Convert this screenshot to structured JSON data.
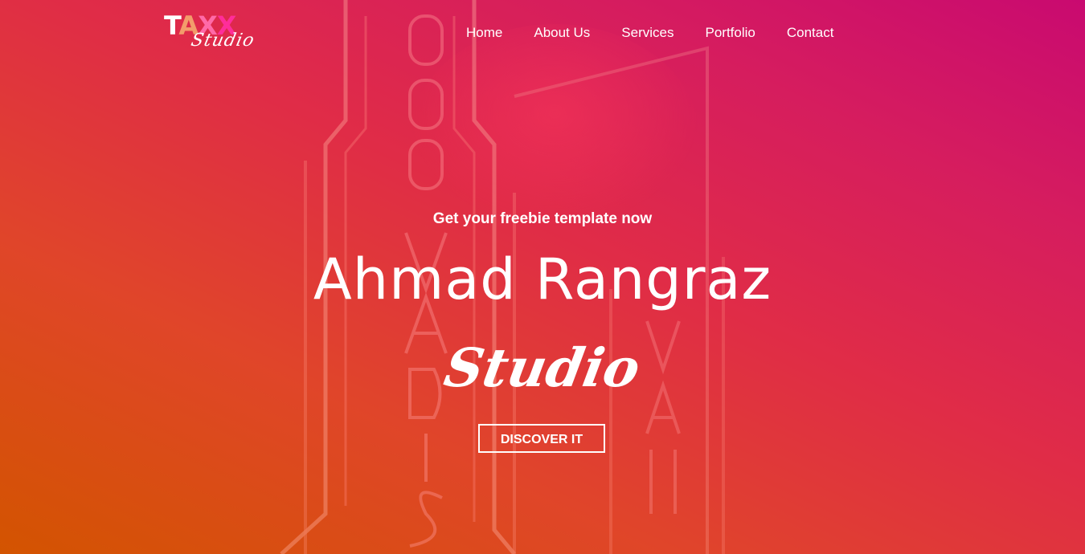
{
  "brand": {
    "logo_letters": [
      "T",
      "A",
      "X",
      "X"
    ],
    "logo_sub": "Studio"
  },
  "nav": {
    "items": [
      {
        "label": "Home"
      },
      {
        "label": "About Us"
      },
      {
        "label": "Services"
      },
      {
        "label": "Portfolio"
      },
      {
        "label": "Contact"
      }
    ]
  },
  "hero": {
    "tagline": "Get your freebie template now",
    "title": "Ahmad Rangraz",
    "script_title": "Studio",
    "cta_label": "DISCOVER IT"
  },
  "colors": {
    "gradient_start": "#d35400",
    "gradient_mid": "#e02c47",
    "gradient_end": "#c90a70",
    "text": "#ffffff"
  }
}
